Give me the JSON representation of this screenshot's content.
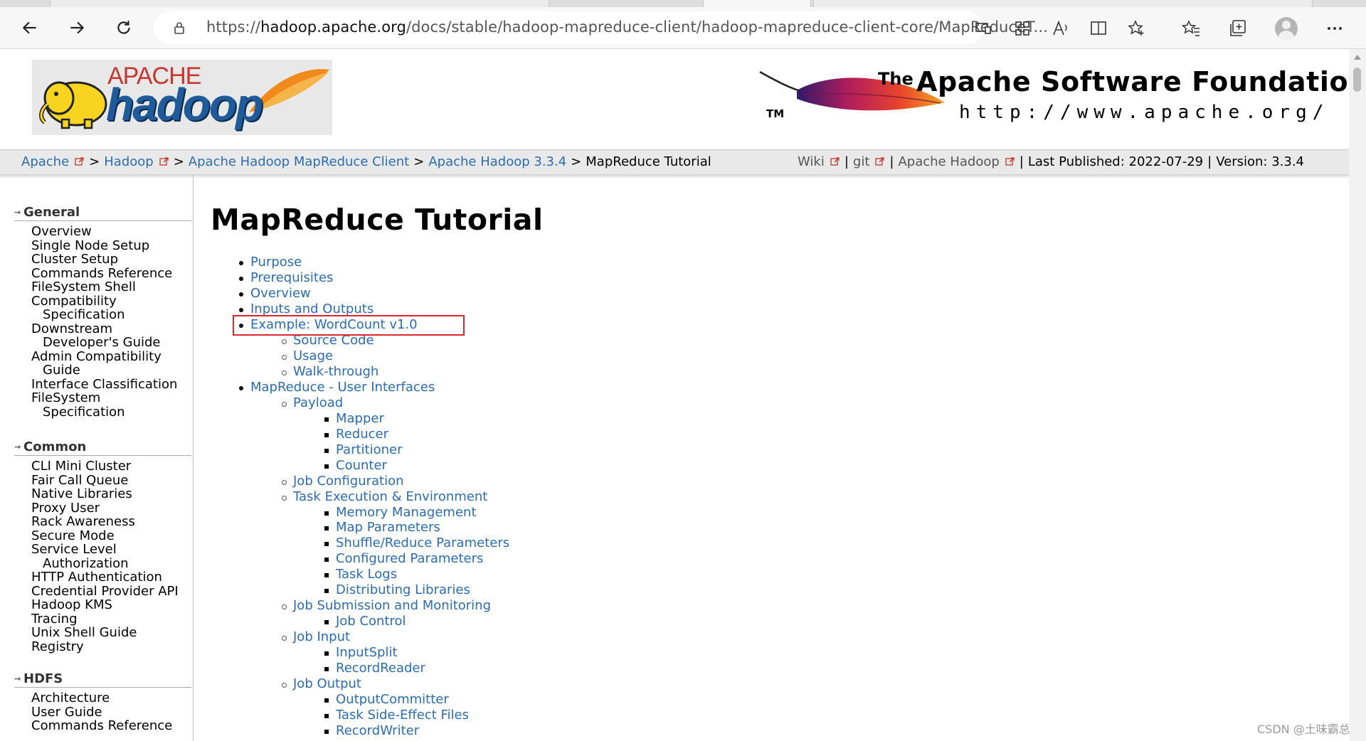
{
  "browser": {
    "url_prefix": "https://",
    "url_host": "hadoop.apache.org",
    "url_path": "/docs/stable/hadoop-mapreduce-client/hadoop-mapreduce-client-core/MapReduceT..."
  },
  "banner": {
    "apache_small": "APACHE",
    "hadoop": "hadoop",
    "asf_the": "The",
    "asf_name": "Apache Software Foundation",
    "asf_url": "http://www.apache.org/",
    "asf_tm": "TM"
  },
  "breadcrumb": {
    "apache": "Apache",
    "hadoop": "Hadoop",
    "client": "Apache Hadoop MapReduce Client",
    "version_link": "Apache Hadoop 3.3.4",
    "current": "MapReduce Tutorial",
    "sep": ">",
    "wiki": "Wiki",
    "git": "git",
    "apache_hadoop": "Apache Hadoop",
    "bar": "|",
    "last_published": "Last Published: 2022-07-29",
    "version": "Version: 3.3.4"
  },
  "nav": {
    "general": {
      "title": "General",
      "items": [
        "Overview",
        "Single Node Setup",
        "Cluster Setup",
        "Commands Reference",
        "FileSystem Shell",
        "Compatibility",
        "Specification",
        "Downstream",
        "Developer's Guide",
        "Admin Compatibility",
        "Guide",
        "Interface Classification",
        "FileSystem",
        "Specification"
      ]
    },
    "common": {
      "title": "Common",
      "items": [
        "CLI Mini Cluster",
        "Fair Call Queue",
        "Native Libraries",
        "Proxy User",
        "Rack Awareness",
        "Secure Mode",
        "Service Level",
        "Authorization",
        "HTTP Authentication",
        "Credential Provider API",
        "Hadoop KMS",
        "Tracing",
        "Unix Shell Guide",
        "Registry"
      ]
    },
    "hdfs": {
      "title": "HDFS",
      "items": [
        "Architecture",
        "User Guide",
        "Commands Reference"
      ]
    }
  },
  "main": {
    "title": "MapReduce Tutorial",
    "toc": [
      "Purpose",
      "Prerequisites",
      "Overview",
      "Inputs and Outputs",
      "Example: WordCount v1.0",
      "Source Code",
      "Usage",
      "Walk-through",
      "MapReduce - User Interfaces",
      "Payload",
      "Mapper",
      "Reducer",
      "Partitioner",
      "Counter",
      "Job Configuration",
      "Task Execution & Environment",
      "Memory Management",
      "Map Parameters",
      "Shuffle/Reduce Parameters",
      "Configured Parameters",
      "Task Logs",
      "Distributing Libraries",
      "Job Submission and Monitoring",
      "Job Control",
      "Job Input",
      "InputSplit",
      "RecordReader",
      "Job Output",
      "OutputCommitter",
      "Task Side-Effect Files",
      "RecordWriter"
    ]
  },
  "watermark": "CSDN @土味霸总"
}
